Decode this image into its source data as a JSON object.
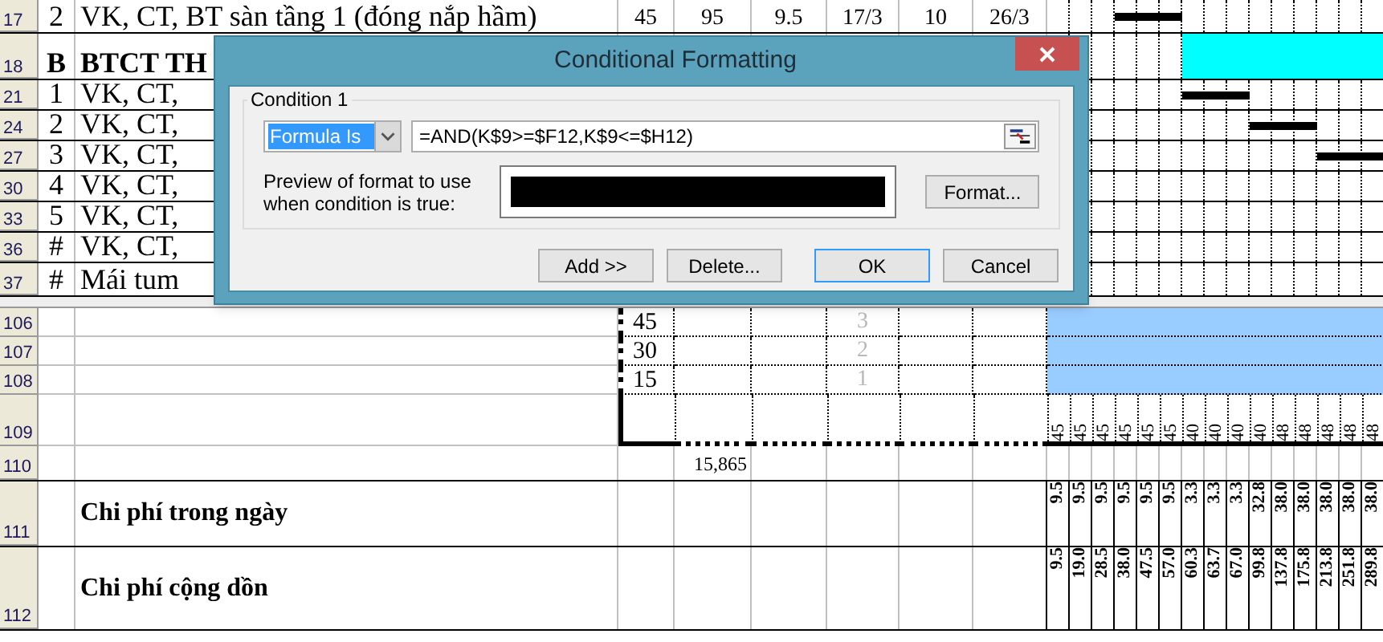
{
  "top_rows": [
    {
      "row": "17",
      "number": "2",
      "name": "VK, CT, BT sàn tầng 1 (đóng nắp hầm)",
      "bold": false,
      "values": [
        "45",
        "95",
        "9.5",
        "17/3",
        "10",
        "26/3"
      ],
      "timeline": [
        {
          "kind": "none"
        },
        {
          "kind": "none"
        },
        {
          "kind": "none"
        },
        {
          "kind": "bar"
        },
        {
          "kind": "bar"
        },
        {
          "kind": "bar"
        },
        {
          "kind": "none"
        },
        {
          "kind": "none"
        },
        {
          "kind": "none"
        },
        {
          "kind": "none"
        },
        {
          "kind": "none"
        },
        {
          "kind": "none"
        },
        {
          "kind": "none"
        },
        {
          "kind": "none"
        },
        {
          "kind": "none"
        }
      ]
    },
    {
      "row": "18",
      "number": "B",
      "name": "BTCT TH",
      "bold": true,
      "values": [],
      "timeline": [
        {
          "kind": "none"
        },
        {
          "kind": "none"
        },
        {
          "kind": "none"
        },
        {
          "kind": "none"
        },
        {
          "kind": "none"
        },
        {
          "kind": "none"
        },
        {
          "kind": "fill"
        },
        {
          "kind": "fill"
        },
        {
          "kind": "fill"
        },
        {
          "kind": "fill"
        },
        {
          "kind": "fill"
        },
        {
          "kind": "fill"
        },
        {
          "kind": "fill"
        },
        {
          "kind": "fill"
        },
        {
          "kind": "fill"
        }
      ]
    },
    {
      "row": "21",
      "number": "1",
      "name": "VK, CT,",
      "bold": false,
      "values": [],
      "timeline": [
        {
          "kind": "none"
        },
        {
          "kind": "none"
        },
        {
          "kind": "none"
        },
        {
          "kind": "none"
        },
        {
          "kind": "none"
        },
        {
          "kind": "none"
        },
        {
          "kind": "bar"
        },
        {
          "kind": "bar"
        },
        {
          "kind": "bar"
        },
        {
          "kind": "none"
        },
        {
          "kind": "none"
        },
        {
          "kind": "none"
        },
        {
          "kind": "none"
        },
        {
          "kind": "none"
        },
        {
          "kind": "none"
        }
      ]
    },
    {
      "row": "24",
      "number": "2",
      "name": "VK, CT,",
      "bold": false,
      "values": [],
      "timeline": [
        {
          "kind": "none"
        },
        {
          "kind": "none"
        },
        {
          "kind": "none"
        },
        {
          "kind": "none"
        },
        {
          "kind": "none"
        },
        {
          "kind": "none"
        },
        {
          "kind": "none"
        },
        {
          "kind": "none"
        },
        {
          "kind": "none"
        },
        {
          "kind": "bar"
        },
        {
          "kind": "bar"
        },
        {
          "kind": "bar"
        },
        {
          "kind": "none"
        },
        {
          "kind": "none"
        },
        {
          "kind": "none"
        }
      ]
    },
    {
      "row": "27",
      "number": "3",
      "name": "VK, CT,",
      "bold": false,
      "values": [],
      "timeline": [
        {
          "kind": "none"
        },
        {
          "kind": "none"
        },
        {
          "kind": "none"
        },
        {
          "kind": "none"
        },
        {
          "kind": "none"
        },
        {
          "kind": "none"
        },
        {
          "kind": "none"
        },
        {
          "kind": "none"
        },
        {
          "kind": "none"
        },
        {
          "kind": "none"
        },
        {
          "kind": "none"
        },
        {
          "kind": "none"
        },
        {
          "kind": "bar"
        },
        {
          "kind": "bar"
        },
        {
          "kind": "bar"
        }
      ]
    },
    {
      "row": "30",
      "number": "4",
      "name": "VK, CT,",
      "bold": false,
      "values": [],
      "timeline": [
        {
          "kind": "none"
        },
        {
          "kind": "none"
        },
        {
          "kind": "none"
        },
        {
          "kind": "none"
        },
        {
          "kind": "none"
        },
        {
          "kind": "none"
        },
        {
          "kind": "none"
        },
        {
          "kind": "none"
        },
        {
          "kind": "none"
        },
        {
          "kind": "none"
        },
        {
          "kind": "none"
        },
        {
          "kind": "none"
        },
        {
          "kind": "none"
        },
        {
          "kind": "none"
        },
        {
          "kind": "none"
        }
      ]
    },
    {
      "row": "33",
      "number": "5",
      "name": "VK, CT,",
      "bold": false,
      "values": [],
      "timeline": [
        {
          "kind": "none"
        },
        {
          "kind": "none"
        },
        {
          "kind": "none"
        },
        {
          "kind": "none"
        },
        {
          "kind": "none"
        },
        {
          "kind": "none"
        },
        {
          "kind": "none"
        },
        {
          "kind": "none"
        },
        {
          "kind": "none"
        },
        {
          "kind": "none"
        },
        {
          "kind": "none"
        },
        {
          "kind": "none"
        },
        {
          "kind": "none"
        },
        {
          "kind": "none"
        },
        {
          "kind": "none"
        }
      ]
    },
    {
      "row": "36",
      "number": "#",
      "name": "VK, CT,",
      "bold": false,
      "values": [],
      "timeline": [
        {
          "kind": "none"
        },
        {
          "kind": "none"
        },
        {
          "kind": "none"
        },
        {
          "kind": "none"
        },
        {
          "kind": "none"
        },
        {
          "kind": "none"
        },
        {
          "kind": "none"
        },
        {
          "kind": "none"
        },
        {
          "kind": "none"
        },
        {
          "kind": "none"
        },
        {
          "kind": "none"
        },
        {
          "kind": "none"
        },
        {
          "kind": "none"
        },
        {
          "kind": "none"
        },
        {
          "kind": "none"
        }
      ]
    },
    {
      "row": "37",
      "number": "#",
      "name": "Mái tum",
      "bold": false,
      "values": [],
      "timeline": [
        {
          "kind": "none"
        },
        {
          "kind": "none"
        },
        {
          "kind": "none"
        },
        {
          "kind": "none"
        },
        {
          "kind": "none"
        },
        {
          "kind": "none"
        },
        {
          "kind": "none"
        },
        {
          "kind": "none"
        },
        {
          "kind": "none"
        },
        {
          "kind": "none"
        },
        {
          "kind": "none"
        },
        {
          "kind": "none"
        },
        {
          "kind": "none"
        },
        {
          "kind": "none"
        },
        {
          "kind": "none"
        }
      ]
    }
  ],
  "chart_rows": [
    {
      "row": "106",
      "value": "45",
      "index": "3"
    },
    {
      "row": "107",
      "value": "30",
      "index": "2"
    },
    {
      "row": "108",
      "value": "15",
      "index": "1"
    }
  ],
  "workers_row": {
    "row": "109",
    "values": [
      "45",
      "45",
      "45",
      "45",
      "45",
      "45",
      "40",
      "40",
      "40",
      "40",
      "48",
      "48",
      "48",
      "48",
      "48"
    ]
  },
  "total_row": {
    "row": "110",
    "total": "15,865"
  },
  "daily_cost_row": {
    "row": "111",
    "label": "Chi phí trong ngày",
    "values": [
      "9.5",
      "9.5",
      "9.5",
      "9.5",
      "9.5",
      "9.5",
      "3.3",
      "3.3",
      "3.3",
      "32.8",
      "38.0",
      "38.0",
      "38.0",
      "38.0",
      "38.0"
    ]
  },
  "cumulative_cost_row": {
    "row": "112",
    "label": "Chi phí cộng dồn",
    "values": [
      "9.5",
      "19.0",
      "28.5",
      "38.0",
      "47.5",
      "57.0",
      "60.3",
      "63.7",
      "67.0",
      "99.8",
      "137.8",
      "175.8",
      "213.8",
      "251.8",
      "289.8"
    ]
  },
  "dialog": {
    "title": "Conditional Formatting",
    "condition_label": "Condition 1",
    "condition_type": "Formula Is",
    "condition_type_selected": true,
    "formula": "=AND(K$9>=$F12,K$9<=$H12)",
    "preview_label": "Preview of format to use when condition is true:",
    "buttons": [
      {
        "label": "Format...",
        "kind": "format"
      },
      {
        "label": "Add >>",
        "kind": "action",
        "default": false
      },
      {
        "label": "Delete...",
        "kind": "action",
        "default": false
      },
      {
        "label": "OK",
        "kind": "action",
        "default": true
      },
      {
        "label": "Cancel",
        "kind": "action",
        "default": false
      }
    ]
  }
}
